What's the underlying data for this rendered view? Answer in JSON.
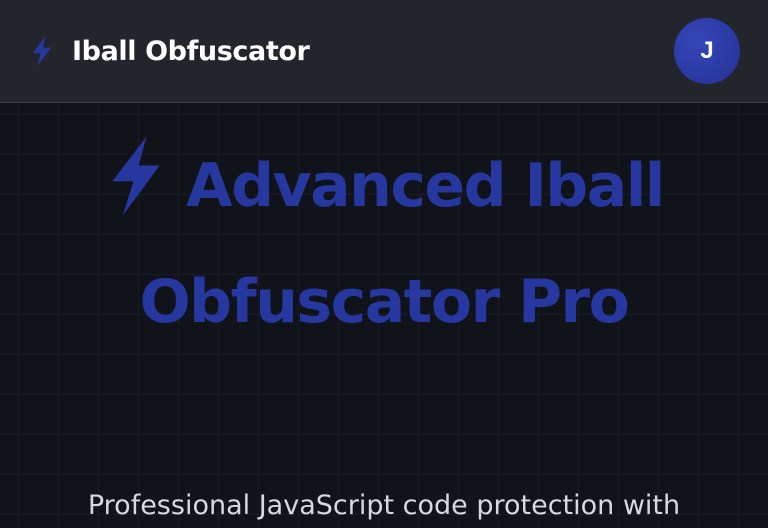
{
  "header": {
    "brand_icon": "lightning-bolt-icon",
    "title": "Iball Obfuscator",
    "avatar_initial": "J"
  },
  "hero": {
    "title_icon": "lightning-bolt-icon",
    "title_line1": "Advanced Iball",
    "title_line2": "Obfuscator Pro",
    "subtitle": "Professional JavaScript code protection with"
  },
  "colors": {
    "header_bg": "#22252c",
    "page_bg": "#10131a",
    "accent": "#2637a0",
    "avatar": "#2a3aa3",
    "text_light": "#d6d9df"
  }
}
